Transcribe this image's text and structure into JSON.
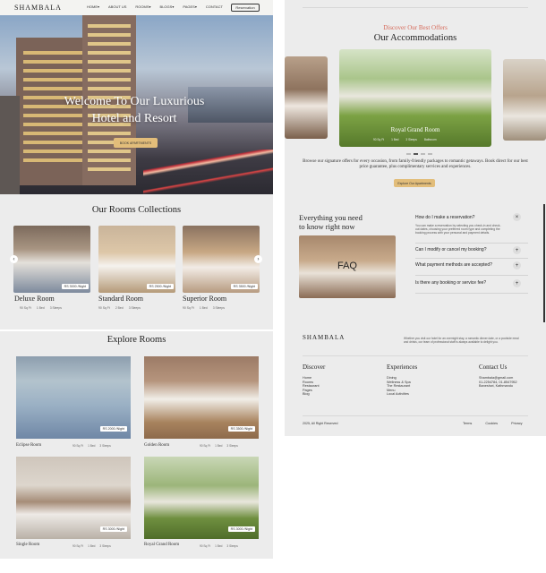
{
  "left": {
    "nav": {
      "logo": "SHAMBALA",
      "items": [
        "HOME",
        "ABOUT US",
        "ROOMS",
        "BLOGS",
        "PAGES",
        "CONTACT"
      ],
      "reservation": "Reservation"
    },
    "hero": {
      "title_line1": "Welcome To Our Luxurious",
      "title_line2": "Hotel and Resort",
      "button": "BOOK APARTMENTS"
    },
    "rooms_collection": {
      "title": "Our Rooms Collections",
      "rooms": [
        {
          "name": "Deluxe Room",
          "price": "RS 3000",
          "per": "/Night",
          "area": "90 Sq Ft",
          "bed": "1 Bed",
          "guests": "3 Sleeps"
        },
        {
          "name": "Standard Room",
          "price": "RS 2500",
          "per": "/Night",
          "area": "90 Sq Ft",
          "bed": "2 Bed",
          "guests": "3 Sleeps"
        },
        {
          "name": "Superior Room",
          "price": "RS 3500",
          "per": "/Night",
          "area": "90 Sq Ft",
          "bed": "1 Bed",
          "guests": "3 Sleeps"
        }
      ]
    },
    "explore": {
      "title": "Explore Rooms",
      "rooms": [
        {
          "name": "Eclipse Room",
          "price": "RS 2000",
          "per": "/Night",
          "area": "90 Sq Ft",
          "bed": "1 Bed",
          "guests": "3 Sleeps"
        },
        {
          "name": "Golden Room",
          "price": "RS 3500",
          "per": "/Night",
          "area": "90 Sq Ft",
          "bed": "1 Bed",
          "guests": "3 Sleeps"
        },
        {
          "name": "Single Room",
          "price": "RS 3000",
          "per": "/Night",
          "area": "90 Sq Ft",
          "bed": "1 Bed",
          "guests": "3 Sleeps"
        },
        {
          "name": "Royal Grand Room",
          "price": "RS 3000",
          "per": "/Night",
          "area": "90 Sq Ft",
          "bed": "1 Bed",
          "guests": "3 Sleeps"
        }
      ]
    }
  },
  "right": {
    "offers_tag": "Discover Our Best Offers",
    "title": "Our Accommodations",
    "slide": {
      "caption": "Royal Grand Room",
      "area": "90 Sq Ft",
      "bed": "1 Bed",
      "guests": "3 Sleeps",
      "bath": "Bathroom"
    },
    "description": "Browse our signature offers for every occasion, from family-friendly packages to romantic getaways. Book direct for our best price guarantee, plus complimentary services and experiences.",
    "explore_button": "Explore Our Apartments",
    "faq": {
      "heading_line1": "Everything you need",
      "heading_line2": "to  know right now",
      "image_label": "FAQ",
      "questions": [
        {
          "q": "How do I make a reservation?",
          "a": "You can make a reservation by selecting you check-in and check-out dates, choosing your preferred room type and completing the booking process with your personal and payment details."
        },
        {
          "q": "Can I modify or cancel my booking?"
        },
        {
          "q": "What payment methods are accepted?"
        },
        {
          "q": "Is there any booking or service fee?"
        }
      ]
    },
    "footer": {
      "logo": "SHAMBALA",
      "about": "Whether you visit our hotel for an overnight stay, a romantic dinner date, or a poolside meal and drinks, our team of professional staff is always available to delight you.",
      "discover": {
        "title": "Discover",
        "items": [
          "Home",
          "Rooms",
          "Restaurant",
          "Pages",
          "Blog"
        ]
      },
      "experiences": {
        "title": "Experiences",
        "items": [
          "Dining",
          "Wellness & Spa",
          "The Restaurant",
          "Menu",
          "Local Activities"
        ]
      },
      "contact": {
        "title": "Contact Us",
        "items": [
          "Shambala@gmail.com",
          "01-2254784, 01-8547952",
          "Baneshwi, Kathmandu"
        ]
      },
      "copyright": "2025, All Right Reserved",
      "links": [
        "Terms",
        "Cookies",
        "Privacy"
      ]
    }
  },
  "colors": {
    "accent": "#e2bd7a",
    "tag": "#d66a5a",
    "bg": "#ececec"
  }
}
